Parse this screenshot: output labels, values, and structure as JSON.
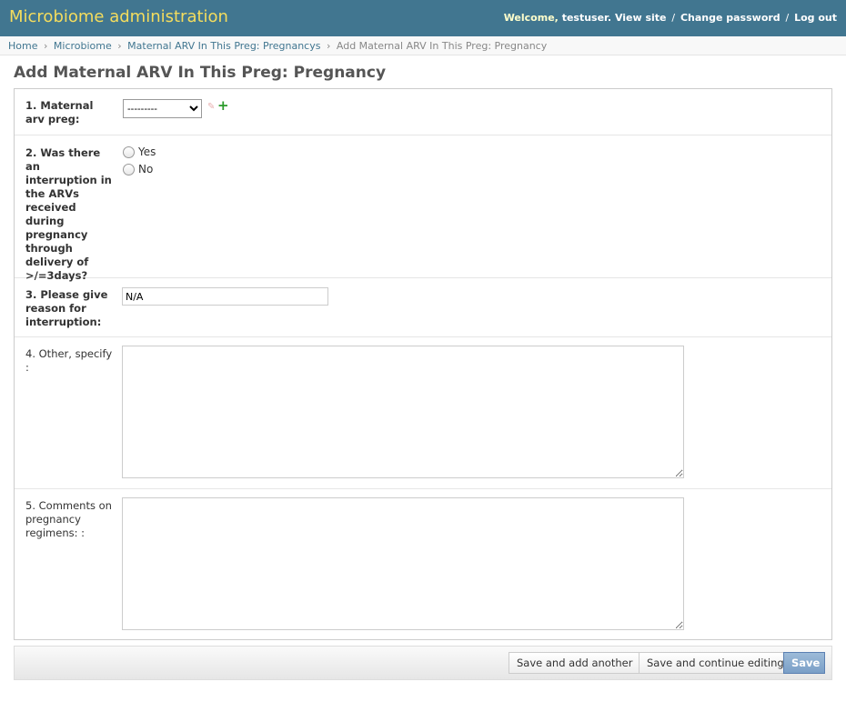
{
  "header": {
    "title": "Microbiome administration",
    "welcome": "Welcome,",
    "username": "testuser.",
    "view_site": "View site",
    "change_password": "Change password",
    "logout": "Log out",
    "sep": "/"
  },
  "breadcrumbs": {
    "home": "Home",
    "app": "Microbiome",
    "model": "Maternal ARV In This Preg: Pregnancys",
    "current": "Add Maternal ARV In This Preg: Pregnancy",
    "sep": "›"
  },
  "page_title": "Add Maternal ARV In This Preg: Pregnancy",
  "form": {
    "q1": {
      "label": "1. Maternal arv preg:",
      "selected": "---------"
    },
    "q2": {
      "label": "2. Was there an interruption in the ARVs received during pregnancy through delivery of >/=3days?",
      "options": [
        "Yes",
        "No"
      ]
    },
    "q3": {
      "label": "3. Please give reason for interruption:",
      "value": "N/A"
    },
    "q4": {
      "label": "4. Other, specify :",
      "value": ""
    },
    "q5": {
      "label": "5. Comments on pregnancy regimens: :",
      "value": ""
    }
  },
  "buttons": {
    "save_add_another": "Save and add another",
    "save_continue": "Save and continue editing",
    "save": "Save"
  },
  "colors": {
    "header_bg": "#417690",
    "branding": "#f5dd5d",
    "link": "#417690",
    "default_button": "#7a9fc7"
  },
  "icons": {
    "change": "pencil-icon",
    "add": "plus-icon"
  }
}
